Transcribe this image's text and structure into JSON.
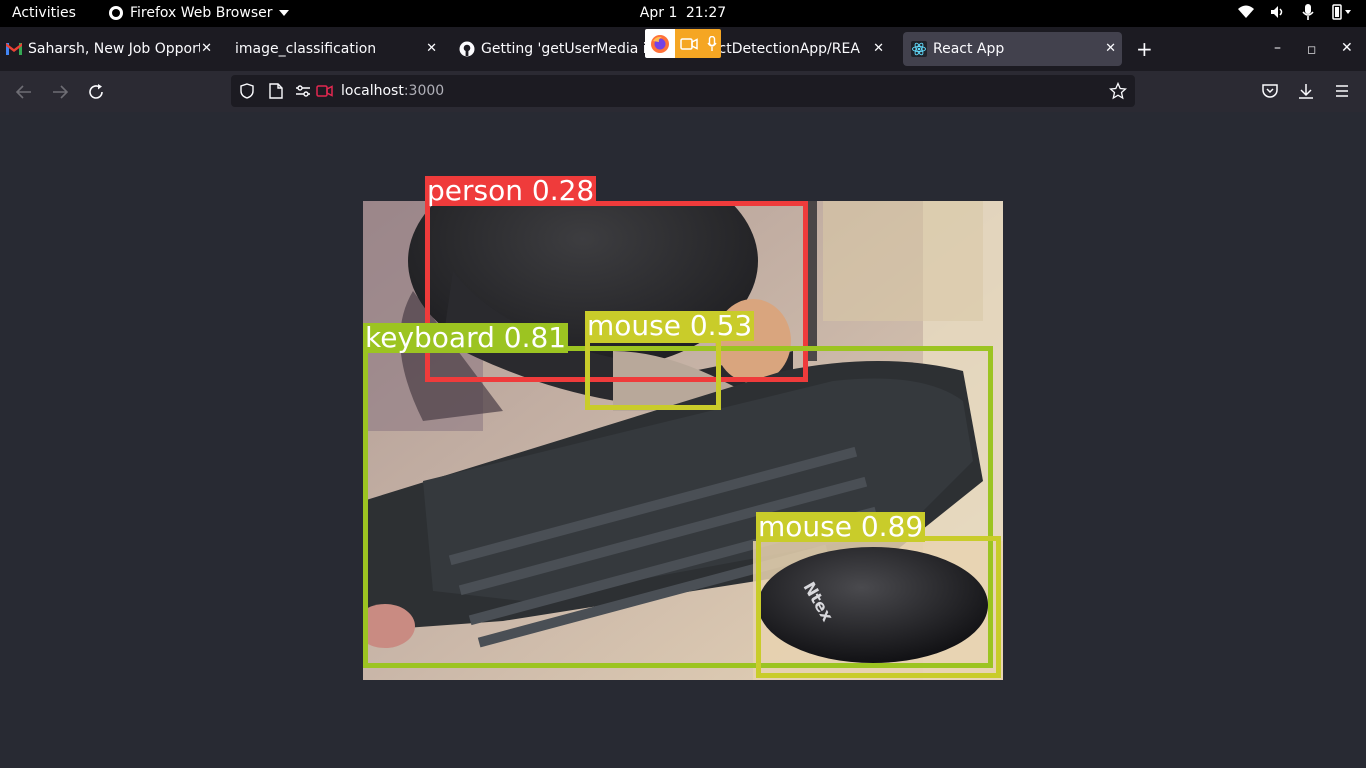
{
  "topbar": {
    "activities": "Activities",
    "app_name": "Firefox Web Browser",
    "date": "Apr 1",
    "time": "21:27"
  },
  "tabs": [
    {
      "title": "Saharsh, New Job Opport",
      "icon": "gmail-icon"
    },
    {
      "title": "image_classification",
      "icon": "blank-icon"
    },
    {
      "title": "Getting 'getUserMedia is",
      "icon": "github-icon"
    },
    {
      "title": "jectDetectionApp/REA",
      "icon": "github-icon"
    },
    {
      "title": "React App",
      "icon": "react-icon",
      "active": true
    }
  ],
  "urlbar": {
    "host": "localhost",
    "port": ":3000"
  },
  "detections": [
    {
      "label": "person 0.28",
      "color": "#ef3b3b"
    },
    {
      "label": "keyboard 0.81",
      "color": "#9cc421"
    },
    {
      "label": "mouse 0.53",
      "color": "#c9cc2a"
    },
    {
      "label": "mouse 0.89",
      "color": "#c9cc2a"
    }
  ],
  "colors": {
    "page_bg": "#282a33",
    "tab_active": "#42414d",
    "webrtc_indicator": "#f5a623"
  }
}
